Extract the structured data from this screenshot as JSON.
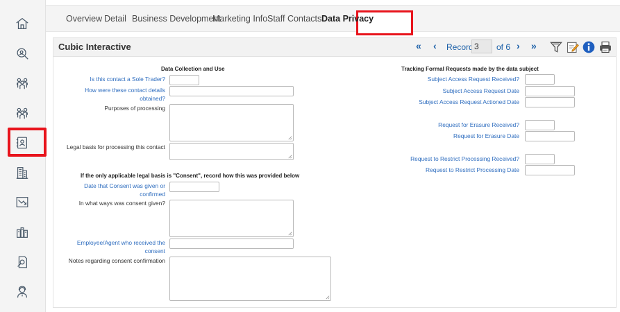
{
  "sidebar": {
    "icons": [
      "home-icon",
      "search-icon",
      "people-icon",
      "people-group-icon",
      "contact-card-icon",
      "buildings-icon",
      "chart-icon",
      "library-icon",
      "document-search-icon",
      "support-user-icon"
    ]
  },
  "tabs": [
    {
      "label": "Overview"
    },
    {
      "label": "Detail"
    },
    {
      "label": "Business Development"
    },
    {
      "label": "Marketing Info"
    },
    {
      "label": "Staff Contacts"
    },
    {
      "label": "Data Privacy"
    }
  ],
  "record": {
    "title": "Cubic Interactive",
    "record_label": "Record",
    "record_number": "3",
    "of_label": "of 6",
    "nav": {
      "first": "«",
      "prev": "‹",
      "next": "›",
      "last": "»"
    }
  },
  "toolbar": {
    "icons": [
      "filter-icon",
      "edit-note-icon",
      "info-icon",
      "print-icon"
    ]
  },
  "left": {
    "section1_title": "Data Collection and Use",
    "sole_trader": "Is this contact a Sole Trader?",
    "how_obtained": "How were these contact details obtained?",
    "purposes": "Purposes of processing",
    "legal_basis": "Legal basis for processing this contact",
    "section2_title": "If the only applicable legal basis is \"Consent\", record how this was provided below",
    "consent_date": "Date that Consent was given or confirmed",
    "consent_ways": "In what ways was consent given?",
    "employee": "Employee/Agent who received the consent",
    "notes": "Notes regarding consent confirmation"
  },
  "right": {
    "section_title": "Tracking Formal Requests made by the data subject",
    "sar_received": "Subject Access Request Received?",
    "sar_date": "Subject Access Request Date",
    "sar_actioned": "Subject Access Request Actioned Date",
    "erasure_received": "Request for Erasure Received?",
    "erasure_date": "Request for Erasure Date",
    "restrict_received": "Request to Restrict Processing Received?",
    "restrict_date": "Request to Restrict Processing Date"
  },
  "colors": {
    "highlight": "#e8141c",
    "link": "#2e6dbf",
    "nav": "#1a5fa8"
  }
}
